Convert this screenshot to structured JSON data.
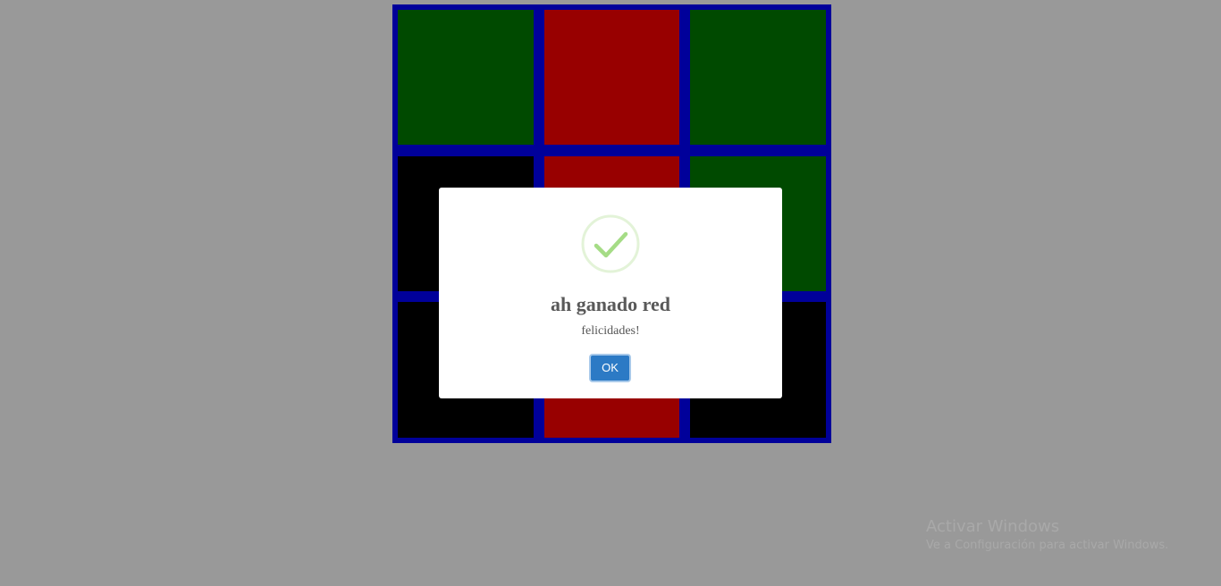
{
  "board": {
    "cells": [
      {
        "row": 1,
        "col": 1,
        "color": "green"
      },
      {
        "row": 1,
        "col": 2,
        "color": "red"
      },
      {
        "row": 1,
        "col": 3,
        "color": "green"
      },
      {
        "row": 2,
        "col": 1,
        "color": "black"
      },
      {
        "row": 2,
        "col": 2,
        "color": "red"
      },
      {
        "row": 2,
        "col": 3,
        "color": "green"
      },
      {
        "row": 3,
        "col": 1,
        "color": "black"
      },
      {
        "row": 3,
        "col": 2,
        "color": "red"
      },
      {
        "row": 3,
        "col": 3,
        "color": "black"
      }
    ],
    "colors": {
      "frame": "#00009a",
      "green": "#004a00",
      "red": "#980000",
      "black": "#000000"
    }
  },
  "dialog": {
    "icon": "success-check-icon",
    "title": "ah ganado red",
    "text": "felicidades!",
    "ok_label": "OK",
    "button_color": "#2c7ac5"
  },
  "watermark": {
    "title": "Activar Windows",
    "subtitle": "Ve a Configuración para activar Windows."
  }
}
